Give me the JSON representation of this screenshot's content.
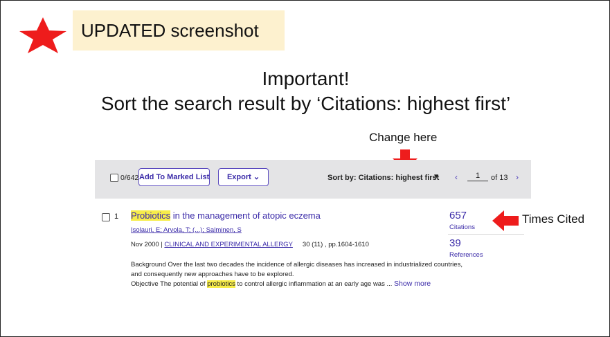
{
  "banner": {
    "text": "UPDATED screenshot"
  },
  "heading": {
    "line1": "Important!",
    "line2": "Sort the search result by ‘Citations: highest first’"
  },
  "callouts": {
    "change_here": "Change here",
    "times_cited": "Times Cited"
  },
  "toolbar": {
    "count": "0/642",
    "add_to_marked_list": "Add To Marked List",
    "export": "Export",
    "export_caret": "⌄",
    "sort_label": "Sort by: Citations: highest first",
    "sort_caret": "▼",
    "page_prev": "‹",
    "page_current": "1",
    "page_of": "of 13",
    "page_next": "›"
  },
  "result": {
    "number": "1",
    "title_highlight": "Probiotics",
    "title_rest": " in the management of atopic eczema",
    "authors": "Isolauri, E; Arvola, T; (...); Salminen, S",
    "date": "Nov 2000 | ",
    "journal": "CLINICAL AND EXPERIMENTAL ALLERGY",
    "volume": "30 (11) , pp.1604-1610",
    "abstract_line1": "Background Over the last two decades the incidence of allergic diseases has increased in industrialized countries,",
    "abstract_line2": "and consequently new approaches have to be explored.",
    "abstract_line3_pre": "Objective The potential of ",
    "abstract_line3_hl": "probiotics",
    "abstract_line3_post": " to control allergic inflammation at an early age was ... ",
    "show_more": "Show more",
    "citations_count": "657",
    "citations_label": "Citations",
    "references_count": "39",
    "references_label": "References"
  },
  "colors": {
    "accent": "#3a2aa8",
    "highlight": "#f7ed4a",
    "arrow": "#ee1c1c",
    "banner": "#fdf1cf",
    "toolbar": "#e4e4e6"
  },
  "icons": [
    "star-icon",
    "arrow-down-icon",
    "arrow-left-icon",
    "checkbox-icon",
    "chevron-down-icon"
  ]
}
